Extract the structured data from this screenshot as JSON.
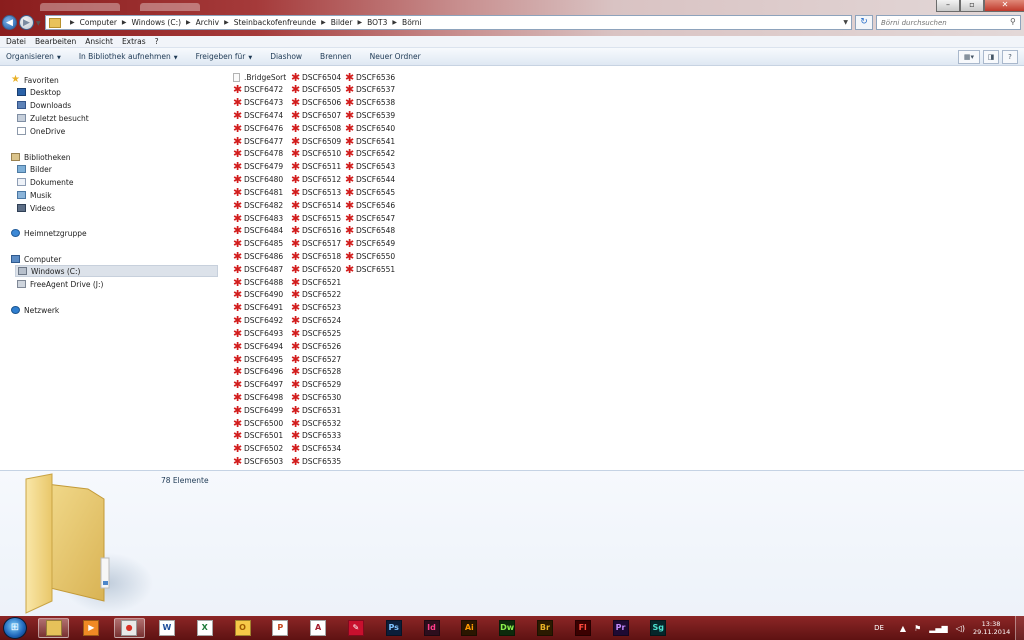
{
  "address_bar": {
    "crumbs": [
      "Computer",
      "Windows (C:)",
      "Archiv",
      "Steinbackofenfreunde",
      "Bilder",
      "BOT3",
      "Börni"
    ]
  },
  "search": {
    "placeholder": "Börni durchsuchen"
  },
  "menu": [
    "Datei",
    "Bearbeiten",
    "Ansicht",
    "Extras",
    "?"
  ],
  "toolbar": [
    {
      "label": "Organisieren",
      "dropdown": true
    },
    {
      "label": "In Bibliothek aufnehmen",
      "dropdown": true
    },
    {
      "label": "Freigeben für",
      "dropdown": true
    },
    {
      "label": "Diashow",
      "dropdown": false
    },
    {
      "label": "Brennen",
      "dropdown": false
    },
    {
      "label": "Neuer Ordner",
      "dropdown": false
    }
  ],
  "navigation": [
    {
      "label": "Favoriten",
      "icon": "star-icon",
      "level": 0
    },
    {
      "label": "Desktop",
      "icon": "desktop-icon",
      "level": 1
    },
    {
      "label": "Downloads",
      "icon": "downloads-icon",
      "level": 1
    },
    {
      "label": "Zuletzt besucht",
      "icon": "recent-places-icon",
      "level": 1
    },
    {
      "label": "OneDrive",
      "icon": "onedrive-icon",
      "level": 1
    },
    {
      "label": "Bibliotheken",
      "icon": "libraries-icon",
      "level": 0
    },
    {
      "label": "Bilder",
      "icon": "pictures-icon",
      "level": 1
    },
    {
      "label": "Dokumente",
      "icon": "documents-icon",
      "level": 1
    },
    {
      "label": "Musik",
      "icon": "music-icon",
      "level": 1
    },
    {
      "label": "Videos",
      "icon": "videos-icon",
      "level": 1
    },
    {
      "label": "Heimnetzgruppe",
      "icon": "homegroup-icon",
      "level": 0
    },
    {
      "label": "Computer",
      "icon": "computer-icon",
      "level": 0
    },
    {
      "label": "Windows (C:)",
      "icon": "hard-drive-icon",
      "level": 1,
      "selected": true
    },
    {
      "label": "FreeAgent Drive (J:)",
      "icon": "external-drive-icon",
      "level": 1
    },
    {
      "label": "Netzwerk",
      "icon": "network-icon",
      "level": 0
    }
  ],
  "files": [
    ".BridgeSort",
    "DSCF6472",
    "DSCF6473",
    "DSCF6474",
    "DSCF6476",
    "DSCF6477",
    "DSCF6478",
    "DSCF6479",
    "DSCF6480",
    "DSCF6481",
    "DSCF6482",
    "DSCF6483",
    "DSCF6484",
    "DSCF6485",
    "DSCF6486",
    "DSCF6487",
    "DSCF6488",
    "DSCF6490",
    "DSCF6491",
    "DSCF6492",
    "DSCF6493",
    "DSCF6494",
    "DSCF6495",
    "DSCF6496",
    "DSCF6497",
    "DSCF6498",
    "DSCF6499",
    "DSCF6500",
    "DSCF6501",
    "DSCF6502",
    "DSCF6503",
    "DSCF6504",
    "DSCF6505",
    "DSCF6506",
    "DSCF6507",
    "DSCF6508",
    "DSCF6509",
    "DSCF6510",
    "DSCF6511",
    "DSCF6512",
    "DSCF6513",
    "DSCF6514",
    "DSCF6515",
    "DSCF6516",
    "DSCF6517",
    "DSCF6518",
    "DSCF6520",
    "DSCF6521",
    "DSCF6522",
    "DSCF6523",
    "DSCF6524",
    "DSCF6525",
    "DSCF6526",
    "DSCF6527",
    "DSCF6528",
    "DSCF6529",
    "DSCF6530",
    "DSCF6531",
    "DSCF6532",
    "DSCF6533",
    "DSCF6534",
    "DSCF6535",
    "DSCF6536",
    "DSCF6537",
    "DSCF6538",
    "DSCF6539",
    "DSCF6540",
    "DSCF6541",
    "DSCF6542",
    "DSCF6543",
    "DSCF6544",
    "DSCF6545",
    "DSCF6546",
    "DSCF6547",
    "DSCF6548",
    "DSCF6549",
    "DSCF6550",
    "DSCF6551"
  ],
  "details": {
    "count": "78 Elemente"
  },
  "taskbar": {
    "apps": [
      {
        "name": "explorer",
        "icon": "folder-icon",
        "text": "",
        "bg": "#e6c15a",
        "fg": "#6b4a10",
        "active": true
      },
      {
        "name": "media-player",
        "icon": "media-player-icon",
        "text": "▶",
        "bg": "#f08a24",
        "fg": "#ffffff"
      },
      {
        "name": "chrome",
        "icon": "chrome-icon",
        "text": "●",
        "bg": "#e9e9e9",
        "fg": "#d93025",
        "active": true
      },
      {
        "name": "word",
        "icon": "word-icon",
        "text": "W",
        "bg": "#ffffff",
        "fg": "#1f4e9b"
      },
      {
        "name": "excel",
        "icon": "excel-icon",
        "text": "X",
        "bg": "#ffffff",
        "fg": "#1d7a38"
      },
      {
        "name": "outlook",
        "icon": "outlook-icon",
        "text": "O",
        "bg": "#f7c948",
        "fg": "#a15c00"
      },
      {
        "name": "powerpoint",
        "icon": "powerpoint-icon",
        "text": "P",
        "bg": "#ffffff",
        "fg": "#c4461d"
      },
      {
        "name": "access",
        "icon": "access-icon",
        "text": "A",
        "bg": "#ffffff",
        "fg": "#a41b2c"
      },
      {
        "name": "acrobat",
        "icon": "acrobat-icon",
        "text": "✎",
        "bg": "#c8102e",
        "fg": "#ffffff"
      },
      {
        "name": "photoshop",
        "icon": "photoshop-icon",
        "text": "Ps",
        "bg": "#0b1e3a",
        "fg": "#7fc3ff"
      },
      {
        "name": "indesign",
        "icon": "indesign-icon",
        "text": "Id",
        "bg": "#2d0e1d",
        "fg": "#ff3d8b"
      },
      {
        "name": "illustrator",
        "icon": "illustrator-icon",
        "text": "Ai",
        "bg": "#2b1600",
        "fg": "#ff9a00"
      },
      {
        "name": "dreamweaver",
        "icon": "dreamweaver-icon",
        "text": "Dw",
        "bg": "#0d2a0c",
        "fg": "#8cf04c"
      },
      {
        "name": "bridge",
        "icon": "bridge-icon",
        "text": "Br",
        "bg": "#2b1a00",
        "fg": "#e7b125"
      },
      {
        "name": "flash",
        "icon": "flash-icon",
        "text": "Fl",
        "bg": "#3b0000",
        "fg": "#ff4a3d"
      },
      {
        "name": "premiere",
        "icon": "premiere-icon",
        "text": "Pr",
        "bg": "#1e0a33",
        "fg": "#c48bff"
      },
      {
        "name": "speedgrade",
        "icon": "speedgrade-icon",
        "text": "Sg",
        "bg": "#06262a",
        "fg": "#4de3d1"
      }
    ],
    "language": "DE",
    "time": "13:38",
    "date": "29.11.2014"
  }
}
